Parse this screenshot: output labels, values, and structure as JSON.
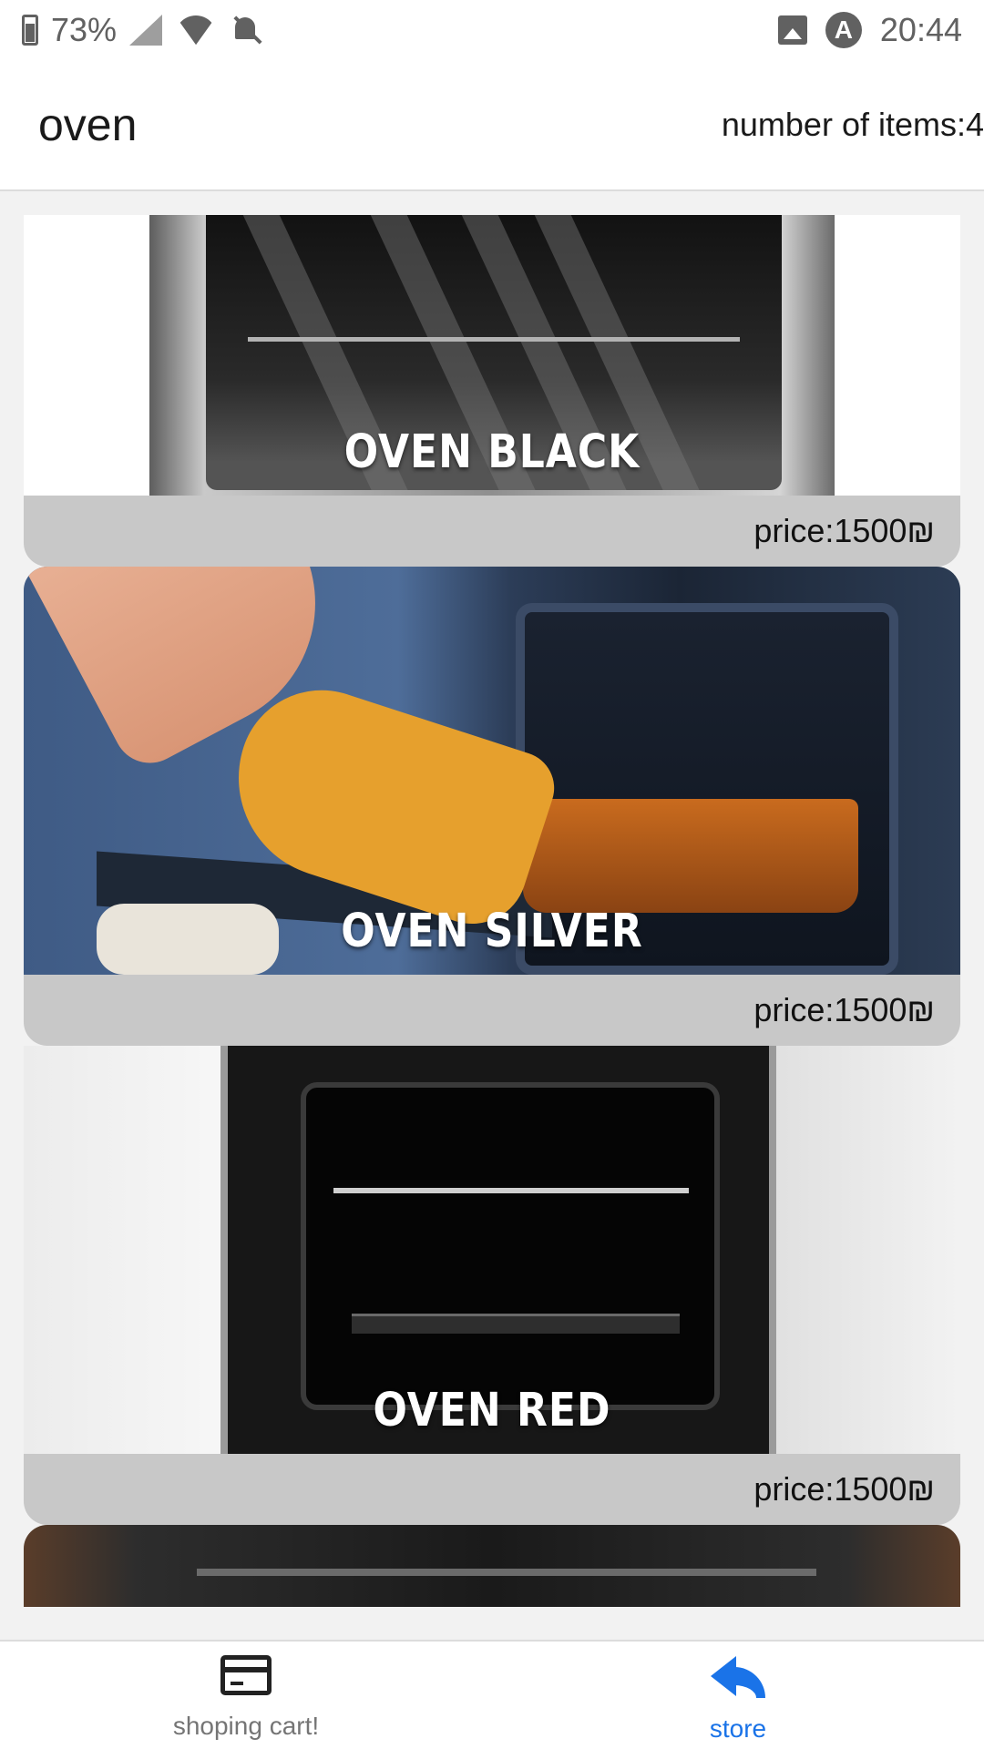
{
  "status_bar": {
    "battery_text": "73%",
    "time": "20:44"
  },
  "header": {
    "title": "oven",
    "item_count": "number of items:4"
  },
  "products": [
    {
      "name": "OVEN BLACK",
      "price": "price:1500₪"
    },
    {
      "name": "OVEN SILVER",
      "price": "price:1500₪"
    },
    {
      "name": "OVEN RED",
      "price": "price:1500₪"
    }
  ],
  "bottom_nav": {
    "cart_label": "shoping cart!",
    "store_label": "store",
    "active_color": "#1a73e8"
  },
  "icons": [
    "battery-icon",
    "signal-icon",
    "wifi-icon",
    "bell-off-icon",
    "image-icon",
    "a-icon",
    "credit-card-icon",
    "reply-icon"
  ]
}
